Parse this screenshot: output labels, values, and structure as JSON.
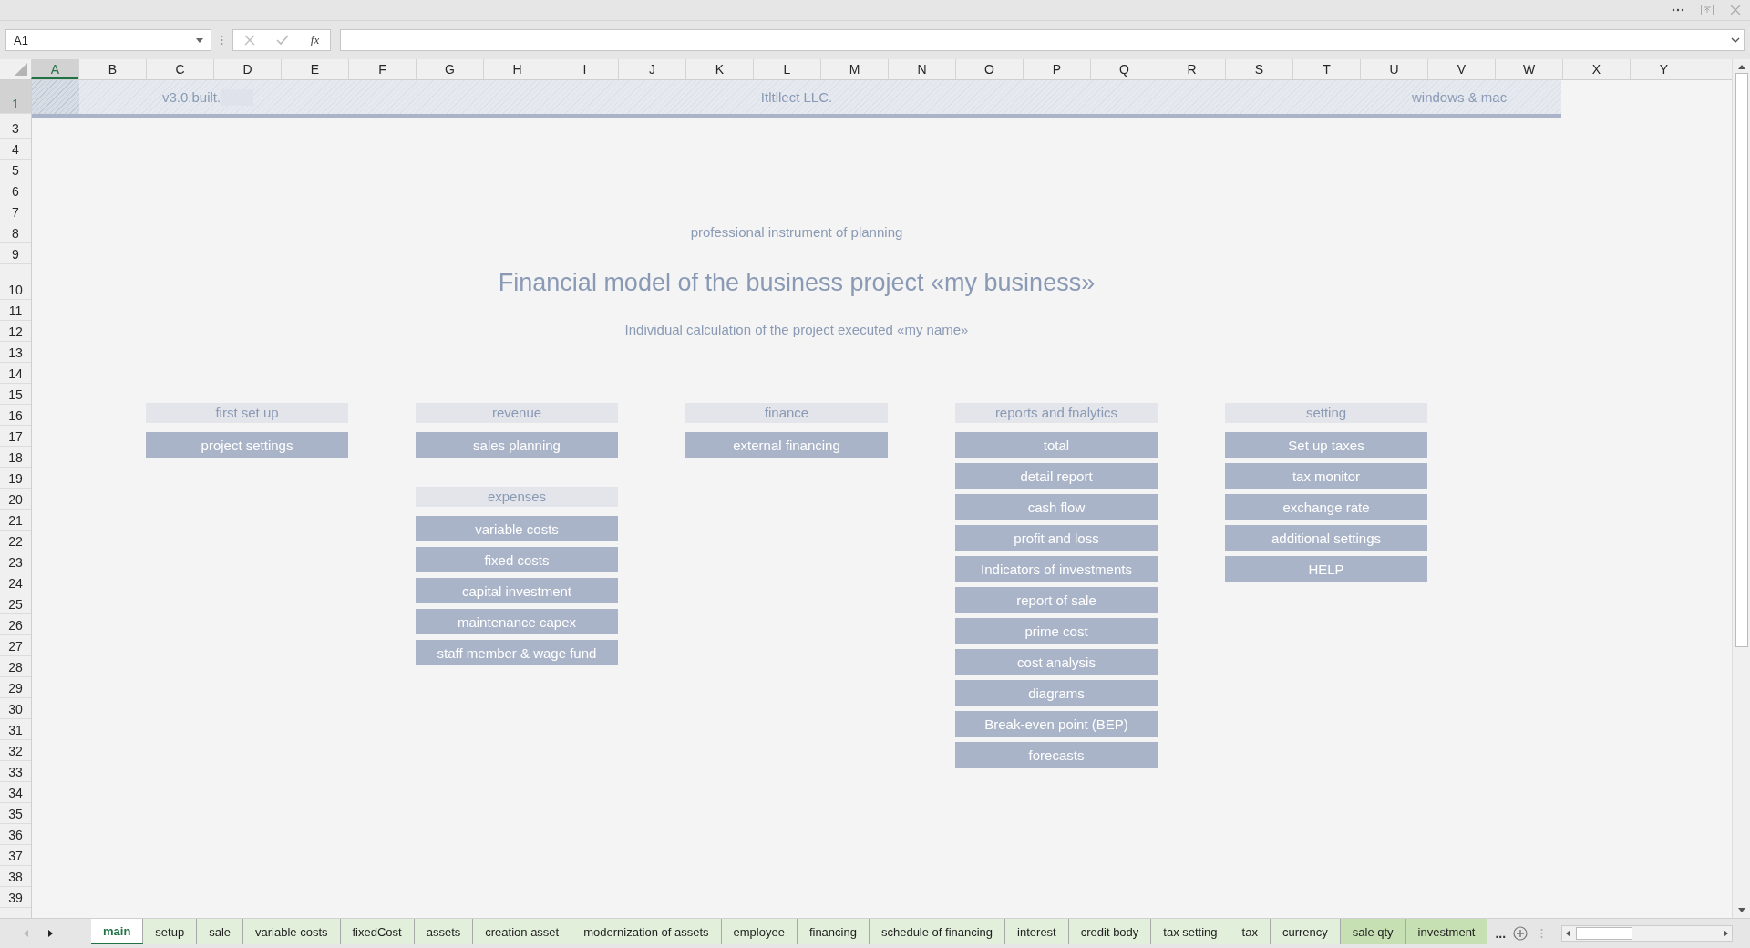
{
  "name_box": {
    "value": "A1"
  },
  "function_button": {
    "label": "fx"
  },
  "columns": [
    {
      "label": "A",
      "selected": true
    },
    {
      "label": "B",
      "selected": false
    },
    {
      "label": "C",
      "selected": false
    },
    {
      "label": "D",
      "selected": false
    },
    {
      "label": "E",
      "selected": false
    },
    {
      "label": "F",
      "selected": false
    },
    {
      "label": "G",
      "selected": false
    },
    {
      "label": "H",
      "selected": false
    },
    {
      "label": "I",
      "selected": false
    },
    {
      "label": "J",
      "selected": false
    },
    {
      "label": "K",
      "selected": false
    },
    {
      "label": "L",
      "selected": false
    },
    {
      "label": "M",
      "selected": false
    },
    {
      "label": "N",
      "selected": false
    },
    {
      "label": "O",
      "selected": false
    },
    {
      "label": "P",
      "selected": false
    },
    {
      "label": "Q",
      "selected": false
    },
    {
      "label": "R",
      "selected": false
    },
    {
      "label": "S",
      "selected": false
    },
    {
      "label": "T",
      "selected": false
    },
    {
      "label": "U",
      "selected": false
    },
    {
      "label": "V",
      "selected": false
    },
    {
      "label": "W",
      "selected": false
    },
    {
      "label": "X",
      "selected": false
    },
    {
      "label": "Y",
      "selected": false
    }
  ],
  "rows": [
    {
      "label": "1",
      "selected": true,
      "kind": "banner"
    },
    {
      "label": "3",
      "selected": false,
      "kind": "normal"
    },
    {
      "label": "4",
      "selected": false,
      "kind": "normal"
    },
    {
      "label": "5",
      "selected": false,
      "kind": "normal"
    },
    {
      "label": "6",
      "selected": false,
      "kind": "normal"
    },
    {
      "label": "7",
      "selected": false,
      "kind": "normal"
    },
    {
      "label": "8",
      "selected": false,
      "kind": "normal"
    },
    {
      "label": "9",
      "selected": false,
      "kind": "normal"
    },
    {
      "label": "10",
      "selected": false,
      "kind": "tall"
    },
    {
      "label": "11",
      "selected": false,
      "kind": "normal"
    },
    {
      "label": "12",
      "selected": false,
      "kind": "normal"
    },
    {
      "label": "13",
      "selected": false,
      "kind": "normal"
    },
    {
      "label": "14",
      "selected": false,
      "kind": "normal"
    },
    {
      "label": "15",
      "selected": false,
      "kind": "normal"
    },
    {
      "label": "16",
      "selected": false,
      "kind": "normal"
    },
    {
      "label": "17",
      "selected": false,
      "kind": "normal"
    },
    {
      "label": "18",
      "selected": false,
      "kind": "normal"
    },
    {
      "label": "19",
      "selected": false,
      "kind": "normal"
    },
    {
      "label": "20",
      "selected": false,
      "kind": "normal"
    },
    {
      "label": "21",
      "selected": false,
      "kind": "normal"
    },
    {
      "label": "22",
      "selected": false,
      "kind": "normal"
    },
    {
      "label": "23",
      "selected": false,
      "kind": "normal"
    },
    {
      "label": "24",
      "selected": false,
      "kind": "normal"
    },
    {
      "label": "25",
      "selected": false,
      "kind": "normal"
    },
    {
      "label": "26",
      "selected": false,
      "kind": "normal"
    },
    {
      "label": "27",
      "selected": false,
      "kind": "normal"
    },
    {
      "label": "28",
      "selected": false,
      "kind": "normal"
    },
    {
      "label": "29",
      "selected": false,
      "kind": "normal"
    },
    {
      "label": "30",
      "selected": false,
      "kind": "normal"
    },
    {
      "label": "31",
      "selected": false,
      "kind": "normal"
    },
    {
      "label": "32",
      "selected": false,
      "kind": "normal"
    },
    {
      "label": "33",
      "selected": false,
      "kind": "normal"
    },
    {
      "label": "34",
      "selected": false,
      "kind": "normal"
    },
    {
      "label": "35",
      "selected": false,
      "kind": "normal"
    },
    {
      "label": "36",
      "selected": false,
      "kind": "normal"
    },
    {
      "label": "37",
      "selected": false,
      "kind": "normal"
    },
    {
      "label": "38",
      "selected": false,
      "kind": "normal"
    },
    {
      "label": "39",
      "selected": false,
      "kind": "normal"
    }
  ],
  "banner": {
    "version": "v3.0.built.",
    "company": "Itltllect LLC.",
    "platforms": "windows & mac"
  },
  "header": {
    "tagline": "professional instrument of planning",
    "title": "Financial model of the business project «my business»",
    "subtitle": "Individual calculation of the project executed «my name»"
  },
  "groups": [
    {
      "sections": [
        {
          "heading": "first set up",
          "buttons": [
            "project settings"
          ]
        }
      ]
    },
    {
      "sections": [
        {
          "heading": "revenue",
          "buttons": [
            "sales planning"
          ]
        },
        {
          "heading": "expenses",
          "buttons": [
            "variable costs",
            "fixed costs",
            "capital investment",
            "maintenance capex",
            "staff member & wage fund"
          ]
        }
      ]
    },
    {
      "sections": [
        {
          "heading": "finance",
          "buttons": [
            "external financing"
          ]
        }
      ]
    },
    {
      "sections": [
        {
          "heading": "reports and fnalytics",
          "buttons": [
            "total",
            "detail report",
            "cash flow",
            "profit and loss",
            "Indicators of investments",
            "report of sale",
            "prime cost",
            "cost analysis",
            "diagrams",
            "Break-even point (BEP)",
            "forecasts"
          ]
        }
      ]
    },
    {
      "sections": [
        {
          "heading": "setting",
          "buttons": [
            "Set up taxes",
            "tax monitor",
            "exchange rate",
            "additional settings",
            "HELP"
          ]
        }
      ]
    }
  ],
  "sheet_tabs": [
    {
      "label": "main",
      "selected": true
    },
    {
      "label": "setup",
      "selected": false,
      "color": "#e2efda"
    },
    {
      "label": "sale",
      "selected": false,
      "color": "#e2efda"
    },
    {
      "label": "variable costs",
      "selected": false,
      "color": "#e2efda"
    },
    {
      "label": "fixedCost",
      "selected": false,
      "color": "#e2efda"
    },
    {
      "label": "assets",
      "selected": false,
      "color": "#e2efda"
    },
    {
      "label": "creation asset",
      "selected": false,
      "color": "#e2efda"
    },
    {
      "label": "modernization of assets",
      "selected": false,
      "color": "#e2efda"
    },
    {
      "label": "employee",
      "selected": false,
      "color": "#e2efda"
    },
    {
      "label": "financing",
      "selected": false,
      "color": "#e2efda"
    },
    {
      "label": "schedule of financing",
      "selected": false,
      "color": "#e2efda"
    },
    {
      "label": "interest",
      "selected": false,
      "color": "#e2efda"
    },
    {
      "label": "credit body",
      "selected": false,
      "color": "#e2efda"
    },
    {
      "label": "tax setting",
      "selected": false,
      "color": "#e2efda"
    },
    {
      "label": "tax",
      "selected": false,
      "color": "#e2efda"
    },
    {
      "label": "currency",
      "selected": false,
      "color": "#e2efda"
    },
    {
      "label": "sale qty",
      "selected": false,
      "color": "#c6e0b4"
    },
    {
      "label": "investment",
      "selected": false,
      "color": "#c6e0b4"
    }
  ],
  "more_tabs": {
    "label": "..."
  }
}
